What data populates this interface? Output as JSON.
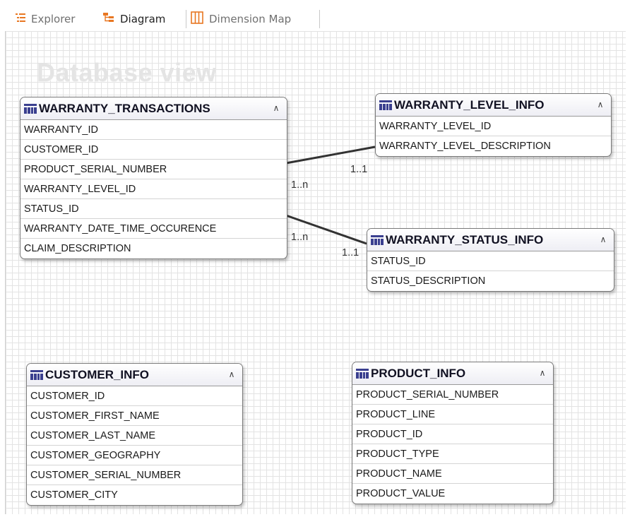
{
  "tabs": [
    {
      "label": "Explorer",
      "icon": "explorer-icon",
      "active": false
    },
    {
      "label": "Diagram",
      "icon": "diagram-icon",
      "active": true
    },
    {
      "label": "Dimension Map",
      "icon": "dimension-map-icon",
      "active": false
    }
  ],
  "canvas": {
    "title": "Database view"
  },
  "colors": {
    "tab_icon": "#e87722",
    "table_icon": "#3a3f8f",
    "relation_line": "#333333"
  },
  "tables": {
    "warranty_transactions": {
      "name": "WARRANTY_TRANSACTIONS",
      "columns": [
        "WARRANTY_ID",
        "CUSTOMER_ID",
        "PRODUCT_SERIAL_NUMBER",
        "WARRANTY_LEVEL_ID",
        "STATUS_ID",
        "WARRANTY_DATE_TIME_OCCURENCE",
        "CLAIM_DESCRIPTION"
      ]
    },
    "warranty_level_info": {
      "name": "WARRANTY_LEVEL_INFO",
      "columns": [
        "WARRANTY_LEVEL_ID",
        "WARRANTY_LEVEL_DESCRIPTION"
      ]
    },
    "warranty_status_info": {
      "name": "WARRANTY_STATUS_INFO",
      "columns": [
        "STATUS_ID",
        "STATUS_DESCRIPTION"
      ]
    },
    "customer_info": {
      "name": "CUSTOMER_INFO",
      "columns": [
        "CUSTOMER_ID",
        "CUSTOMER_FIRST_NAME",
        "CUSTOMER_LAST_NAME",
        "CUSTOMER_GEOGRAPHY",
        "CUSTOMER_SERIAL_NUMBER",
        "CUSTOMER_CITY"
      ]
    },
    "product_info": {
      "name": "PRODUCT_INFO",
      "columns": [
        "PRODUCT_SERIAL_NUMBER",
        "PRODUCT_LINE",
        "PRODUCT_ID",
        "PRODUCT_TYPE",
        "PRODUCT_NAME",
        "PRODUCT_VALUE"
      ]
    }
  },
  "relations": [
    {
      "from": "WARRANTY_TRANSACTIONS",
      "to": "WARRANTY_LEVEL_INFO",
      "from_card": "1..n",
      "to_card": "1..1"
    },
    {
      "from": "WARRANTY_TRANSACTIONS",
      "to": "WARRANTY_STATUS_INFO",
      "from_card": "1..n",
      "to_card": "1..1"
    }
  ]
}
